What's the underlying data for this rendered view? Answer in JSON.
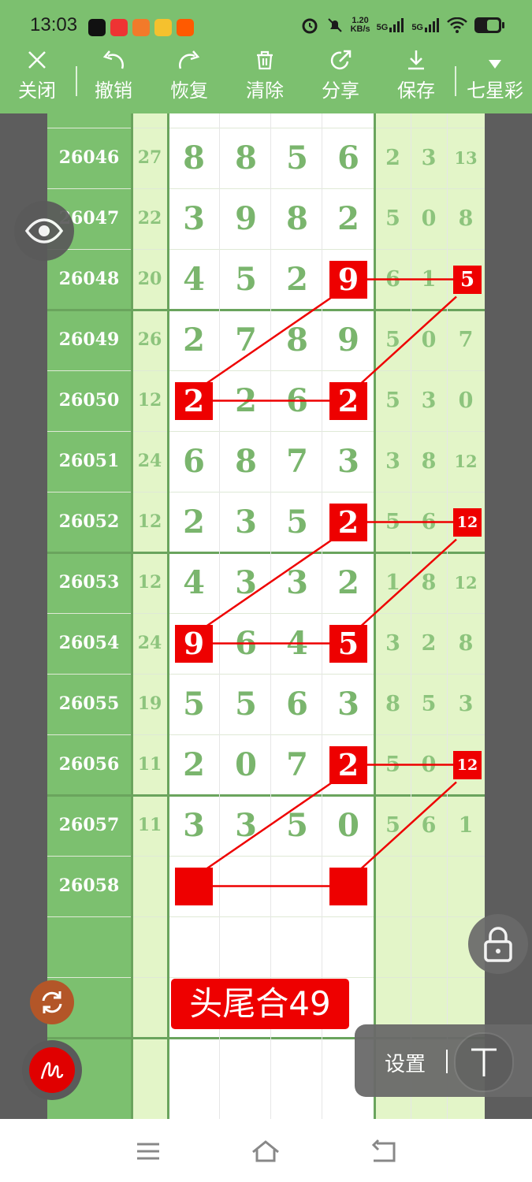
{
  "status_bar": {
    "time": "13:03",
    "net_speed_value": "1.20",
    "net_speed_unit": "KB/s",
    "sim1": "5G",
    "sim2": "5G",
    "app_icons": [
      "tiktok-icon",
      "app-red-icon",
      "video-app-icon",
      "yellow-app-icon",
      "taobao-icon"
    ],
    "system_icons": [
      "alarm-icon",
      "mute-icon",
      "signal-icon",
      "wifi-icon",
      "battery-icon"
    ]
  },
  "toolbar": {
    "items": [
      {
        "label": "关闭",
        "icon": "close-icon"
      },
      {
        "label": "撤销",
        "icon": "undo-icon"
      },
      {
        "label": "恢复",
        "icon": "redo-icon"
      },
      {
        "label": "清除",
        "icon": "trash-icon"
      },
      {
        "label": "分享",
        "icon": "share-icon"
      },
      {
        "label": "保存",
        "icon": "download-icon"
      },
      {
        "label": "七星彩",
        "icon": "dropdown-triangle-icon"
      }
    ]
  },
  "table": {
    "rows": [
      {
        "id": "26046",
        "sum": "27",
        "digits": [
          "8",
          "8",
          "5",
          "6"
        ],
        "tails": [
          "2",
          "3",
          "13"
        ]
      },
      {
        "id": "26047",
        "sum": "22",
        "digits": [
          "3",
          "9",
          "8",
          "2"
        ],
        "tails": [
          "5",
          "0",
          "8"
        ]
      },
      {
        "id": "26048",
        "sum": "20",
        "digits": [
          "4",
          "5",
          "2",
          "9"
        ],
        "tails": [
          "6",
          "1",
          "5"
        ]
      },
      {
        "id": "26049",
        "sum": "26",
        "digits": [
          "2",
          "7",
          "8",
          "9"
        ],
        "tails": [
          "5",
          "0",
          "7"
        ]
      },
      {
        "id": "26050",
        "sum": "12",
        "digits": [
          "2",
          "2",
          "6",
          "2"
        ],
        "tails": [
          "5",
          "3",
          "0"
        ]
      },
      {
        "id": "26051",
        "sum": "24",
        "digits": [
          "6",
          "8",
          "7",
          "3"
        ],
        "tails": [
          "3",
          "8",
          "12"
        ]
      },
      {
        "id": "26052",
        "sum": "12",
        "digits": [
          "2",
          "3",
          "5",
          "2"
        ],
        "tails": [
          "5",
          "6",
          "12"
        ]
      },
      {
        "id": "26053",
        "sum": "12",
        "digits": [
          "4",
          "3",
          "3",
          "2"
        ],
        "tails": [
          "1",
          "8",
          "12"
        ]
      },
      {
        "id": "26054",
        "sum": "24",
        "digits": [
          "9",
          "6",
          "4",
          "5"
        ],
        "tails": [
          "3",
          "2",
          "8"
        ]
      },
      {
        "id": "26055",
        "sum": "19",
        "digits": [
          "5",
          "5",
          "6",
          "3"
        ],
        "tails": [
          "8",
          "5",
          "3"
        ]
      },
      {
        "id": "26056",
        "sum": "11",
        "digits": [
          "2",
          "0",
          "7",
          "2"
        ],
        "tails": [
          "5",
          "0",
          "12"
        ]
      },
      {
        "id": "26057",
        "sum": "11",
        "digits": [
          "3",
          "3",
          "5",
          "0"
        ],
        "tails": [
          "5",
          "6",
          "1"
        ]
      },
      {
        "id": "26058",
        "sum": "",
        "digits": [
          "",
          "",
          "",
          ""
        ],
        "tails": [
          "",
          "",
          ""
        ]
      }
    ],
    "highlights": [
      {
        "row": 2,
        "col": "d3"
      },
      {
        "row": 2,
        "col": "t2"
      },
      {
        "row": 4,
        "col": "d0"
      },
      {
        "row": 4,
        "col": "d3"
      },
      {
        "row": 6,
        "col": "d3"
      },
      {
        "row": 6,
        "col": "t2"
      },
      {
        "row": 8,
        "col": "d0"
      },
      {
        "row": 8,
        "col": "d3"
      },
      {
        "row": 10,
        "col": "d3"
      },
      {
        "row": 10,
        "col": "t2"
      },
      {
        "row": 12,
        "col": "d0"
      },
      {
        "row": 12,
        "col": "d3"
      }
    ],
    "annotation_color": "#ee0000"
  },
  "banner": {
    "text": "头尾合49"
  },
  "floating": {
    "eye_icon": "eye-icon",
    "lock_icon": "lock-icon",
    "refresh_icon": "refresh-icon",
    "pen_icon": "pen-icon",
    "settings_label": "设置",
    "text_tool_label": "T"
  },
  "nav_bar": {
    "icons": [
      "menu-icon",
      "home-icon",
      "back-icon"
    ]
  }
}
